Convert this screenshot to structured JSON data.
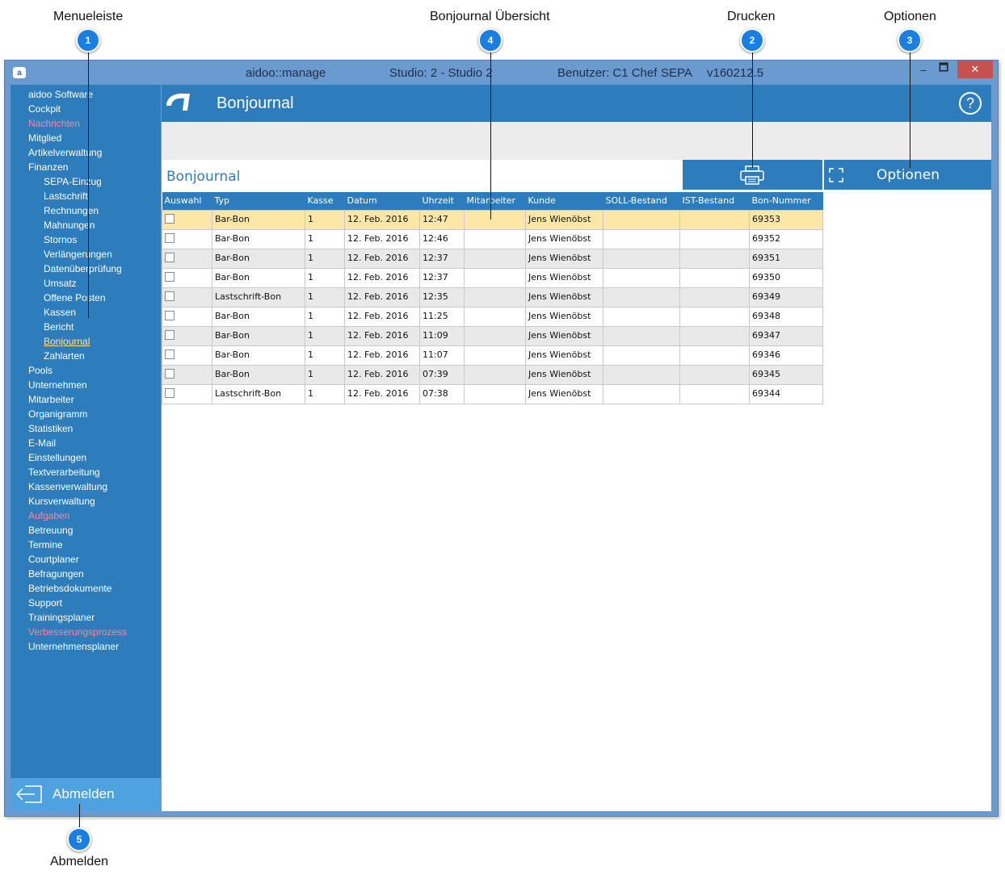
{
  "annotations": [
    {
      "label": "Menueleiste",
      "number": "1"
    },
    {
      "label": "Bonjournal Übersicht",
      "number": "4"
    },
    {
      "label": "Drucken",
      "number": "2"
    },
    {
      "label": "Optionen",
      "number": "3"
    },
    {
      "label": "Abmelden",
      "number": "5"
    }
  ],
  "window": {
    "app_name": "aidoo::manage",
    "studio": "Studio: 2 - Studio 2",
    "user": "Benutzer: C1 Chef",
    "mode": "SEPA",
    "version": "v160212.5",
    "min_glyph": "–",
    "max_glyph": "🗖",
    "close_glyph": "✕"
  },
  "sidebar": {
    "items": [
      {
        "label": "aidoo Software"
      },
      {
        "label": "Cockpit"
      },
      {
        "label": "Nachrichten"
      },
      {
        "label": "Mitglied"
      },
      {
        "label": "Artikelverwaltung"
      },
      {
        "label": "Finanzen"
      },
      {
        "label": "SEPA-Einzug"
      },
      {
        "label": "Lastschrift"
      },
      {
        "label": "Rechnungen"
      },
      {
        "label": "Mahnungen"
      },
      {
        "label": "Stornos"
      },
      {
        "label": "Verlängerungen"
      },
      {
        "label": "Datenüberprüfung"
      },
      {
        "label": "Umsatz"
      },
      {
        "label": "Offene Posten"
      },
      {
        "label": "Kassen"
      },
      {
        "label": "Bericht"
      },
      {
        "label": "Bonjournal"
      },
      {
        "label": "Zahlarten"
      },
      {
        "label": "Pools"
      },
      {
        "label": "Unternehmen"
      },
      {
        "label": "Mitarbeiter"
      },
      {
        "label": "Organigramm"
      },
      {
        "label": "Statistiken"
      },
      {
        "label": "E-Mail"
      },
      {
        "label": "Einstellungen"
      },
      {
        "label": "Textverarbeitung"
      },
      {
        "label": "Kassenverwaltung"
      },
      {
        "label": "Kursverwaltung"
      },
      {
        "label": "Aufgaben"
      },
      {
        "label": "Betreuung"
      },
      {
        "label": "Termine"
      },
      {
        "label": "Courtplaner"
      },
      {
        "label": "Befragungen"
      },
      {
        "label": "Betriebsdokumente"
      },
      {
        "label": "Support"
      },
      {
        "label": "Trainingsplaner"
      },
      {
        "label": "Verbesserungsprozess"
      },
      {
        "label": "Unternehmensplaner"
      }
    ],
    "logout_label": "Abmelden"
  },
  "main": {
    "header_title": "Bonjournal",
    "help_glyph": "?",
    "sub_title": "Bonjournal",
    "options_label": "Optionen"
  },
  "table": {
    "columns": [
      "Auswahl",
      "Typ",
      "Kasse",
      "Datum",
      "Uhrzeit",
      "Mitarbeiter",
      "Kunde",
      "SOLL-Bestand",
      "IST-Bestand",
      "Bon-Nummer"
    ],
    "rows": [
      {
        "typ": "Bar-Bon",
        "kasse": "1",
        "datum": "12. Feb. 2016",
        "uhrzeit": "12:47",
        "mitarbeiter": "",
        "kunde": "Jens Wienöbst",
        "soll": "",
        "ist": "",
        "bon": "69353"
      },
      {
        "typ": "Bar-Bon",
        "kasse": "1",
        "datum": "12. Feb. 2016",
        "uhrzeit": "12:46",
        "mitarbeiter": "",
        "kunde": "Jens Wienöbst",
        "soll": "",
        "ist": "",
        "bon": "69352"
      },
      {
        "typ": "Bar-Bon",
        "kasse": "1",
        "datum": "12. Feb. 2016",
        "uhrzeit": "12:37",
        "mitarbeiter": "",
        "kunde": "Jens Wienöbst",
        "soll": "",
        "ist": "",
        "bon": "69351"
      },
      {
        "typ": "Bar-Bon",
        "kasse": "1",
        "datum": "12. Feb. 2016",
        "uhrzeit": "12:37",
        "mitarbeiter": "",
        "kunde": "Jens Wienöbst",
        "soll": "",
        "ist": "",
        "bon": "69350"
      },
      {
        "typ": "Lastschrift-Bon",
        "kasse": "1",
        "datum": "12. Feb. 2016",
        "uhrzeit": "12:35",
        "mitarbeiter": "",
        "kunde": "Jens Wienöbst",
        "soll": "",
        "ist": "",
        "bon": "69349"
      },
      {
        "typ": "Bar-Bon",
        "kasse": "1",
        "datum": "12. Feb. 2016",
        "uhrzeit": "11:25",
        "mitarbeiter": "",
        "kunde": "Jens Wienöbst",
        "soll": "",
        "ist": "",
        "bon": "69348"
      },
      {
        "typ": "Bar-Bon",
        "kasse": "1",
        "datum": "12. Feb. 2016",
        "uhrzeit": "11:09",
        "mitarbeiter": "",
        "kunde": "Jens Wienöbst",
        "soll": "",
        "ist": "",
        "bon": "69347"
      },
      {
        "typ": "Bar-Bon",
        "kasse": "1",
        "datum": "12. Feb. 2016",
        "uhrzeit": "11:07",
        "mitarbeiter": "",
        "kunde": "Jens Wienöbst",
        "soll": "",
        "ist": "",
        "bon": "69346"
      },
      {
        "typ": "Bar-Bon",
        "kasse": "1",
        "datum": "12. Feb. 2016",
        "uhrzeit": "07:39",
        "mitarbeiter": "",
        "kunde": "Jens Wienöbst",
        "soll": "",
        "ist": "",
        "bon": "69345"
      },
      {
        "typ": "Lastschrift-Bon",
        "kasse": "1",
        "datum": "12. Feb. 2016",
        "uhrzeit": "07:38",
        "mitarbeiter": "",
        "kunde": "Jens Wienöbst",
        "soll": "",
        "ist": "",
        "bon": "69344"
      }
    ]
  },
  "colors": {
    "accent": "#2d7dbd",
    "selected_row": "#fde7a6",
    "callout": "#1a7fe0",
    "red_menu": "#f08aa0",
    "active_menu": "#ffe58a"
  }
}
